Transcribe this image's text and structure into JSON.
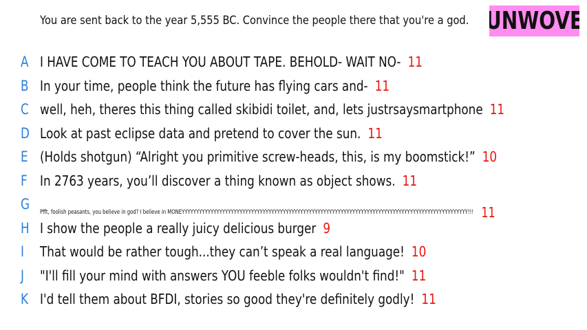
{
  "prompt": "You are sent back to the year 5,555 BC. Convince the people there that you're a god.",
  "logo": "UNWOVE",
  "colors": {
    "letter": "#2e7fd6",
    "score": "#e8150f",
    "logo_bg": "#ff8cf0",
    "text": "#111111"
  },
  "answers": [
    {
      "letter": "A",
      "text": "I HAVE COME TO TEACH YOU ABOUT TAPE. BEHOLD- WAIT NO-",
      "score": "11"
    },
    {
      "letter": "B",
      "text": "In your time, people think the future has flying cars and-",
      "score": "11"
    },
    {
      "letter": "C",
      "text": "well, heh, theres this thing called skibidi toilet, and, lets justrsaysmartphone",
      "score": "11"
    },
    {
      "letter": "D",
      "text": "Look at past eclipse data and pretend to cover the sun.",
      "score": "11"
    },
    {
      "letter": "E",
      "text": "(Holds shotgun) “Alright you primitive screw-heads, this, is my boomstick!”",
      "score": "10"
    },
    {
      "letter": "F",
      "text": "In 2763 years, you’ll discover a thing known as object shows.",
      "score": "11"
    },
    {
      "letter": "G",
      "text": "Pfft, foolish peasants, you believe in god? I believe in MONEYYYYYYYYYYYYYYYYYYYYYYYYYYYYYYYYYYYYYYYYYYYYYYYYYYYYYYYYYYYYYYYYYYYYYYYYYYYYYYYYYYYYYYYYYYYYYYYYYYY!!!",
      "score": "11"
    },
    {
      "letter": "H",
      "text": "I show the people a really juicy delicious burger",
      "score": "9"
    },
    {
      "letter": "I",
      "text": "That would be rather tough...they can’t speak a real language!",
      "score": "10"
    },
    {
      "letter": "J",
      "text": "\"I'll fill your mind with answers YOU feeble folks wouldn't find!\"",
      "score": "11"
    },
    {
      "letter": "K",
      "text": "I'd tell them about BFDI, stories so good they're definitely godly!",
      "score": "11"
    }
  ]
}
